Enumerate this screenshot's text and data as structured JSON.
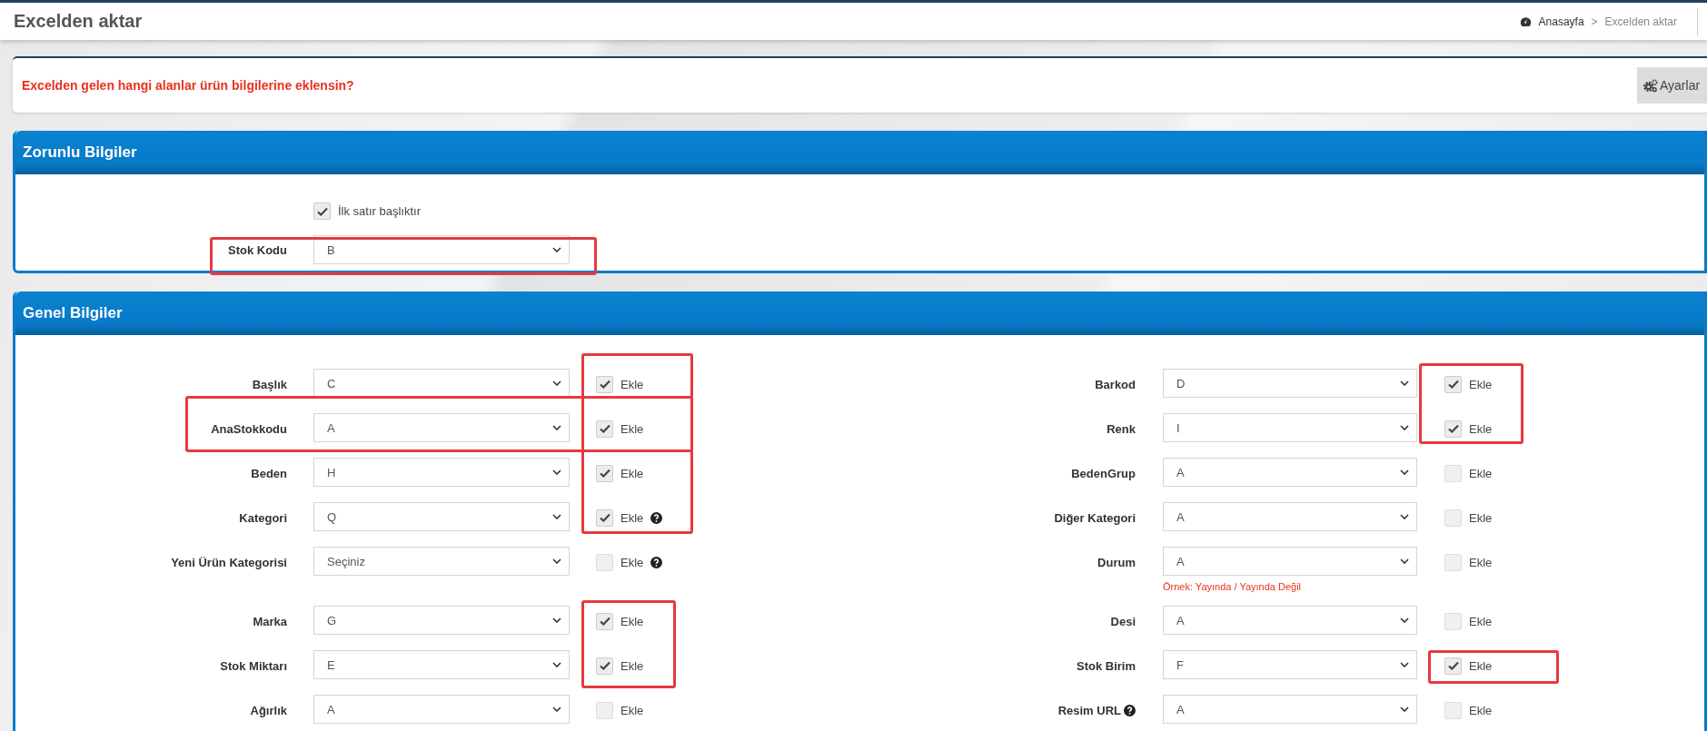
{
  "page": {
    "title": "Excelden aktar"
  },
  "breadcrumb": [
    {
      "label": "Anasayfa",
      "kind": "home"
    },
    {
      "label": ">",
      "kind": "separator"
    },
    {
      "label": "Excelden aktar",
      "kind": "current"
    }
  ],
  "notice": {
    "text": "Excelden gelen hangi alanlar ürün bilgilerine eklensin?",
    "button": "Ayarlar"
  },
  "required_panel": {
    "title": "Zorunlu Bilgiler",
    "header_checkbox": {
      "label": "İlk satır başlıktır",
      "checked": true
    },
    "field": {
      "label": "Stok Kodu",
      "value": "B"
    }
  },
  "general_panel": {
    "title": "Genel Bilgiler",
    "rows": [
      {
        "left": {
          "label": "Başlık",
          "value": "C",
          "add": "Ekle",
          "checked": true
        },
        "right": {
          "label": "Barkod",
          "value": "D",
          "add": "Ekle",
          "checked": true
        }
      },
      {
        "left": {
          "label": "AnaStokkodu",
          "value": "A",
          "add": "Ekle",
          "checked": true
        },
        "right": {
          "label": "Renk",
          "value": "I",
          "add": "Ekle",
          "checked": true
        }
      },
      {
        "left": {
          "label": "Beden",
          "value": "H",
          "add": "Ekle",
          "checked": true
        },
        "right": {
          "label": "BedenGrup",
          "value": "A",
          "add": "Ekle",
          "checked": false
        }
      },
      {
        "left": {
          "label": "Kategori",
          "value": "Q",
          "add": "Ekle",
          "checked": true,
          "add_help": true
        },
        "right": {
          "label": "Diğer Kategori",
          "value": "A",
          "add": "Ekle",
          "checked": false
        }
      },
      {
        "left": {
          "label": "Yeni Ürün Kategorisi",
          "value": "Seçiniz",
          "add": "Ekle",
          "checked": false,
          "add_help": true
        },
        "right": {
          "label": "Durum",
          "value": "A",
          "add": "Ekle",
          "checked": false,
          "hint": "Örnek: Yayında / Yayında Değil"
        }
      },
      {
        "left": {
          "label": "Marka",
          "value": "G",
          "add": "Ekle",
          "checked": true
        },
        "right": {
          "label": "Desi",
          "value": "A",
          "add": "Ekle",
          "checked": false
        }
      },
      {
        "left": {
          "label": "Stok Miktarı",
          "value": "E",
          "add": "Ekle",
          "checked": true
        },
        "right": {
          "label": "Stok Birim",
          "value": "F",
          "add": "Ekle",
          "checked": true
        }
      },
      {
        "left": {
          "label": "Ağırlık",
          "value": "A",
          "add": "Ekle",
          "checked": false
        },
        "right": {
          "label": "Resim URL",
          "value": "A",
          "add": "Ekle",
          "checked": false,
          "label_help": true
        }
      }
    ]
  }
}
